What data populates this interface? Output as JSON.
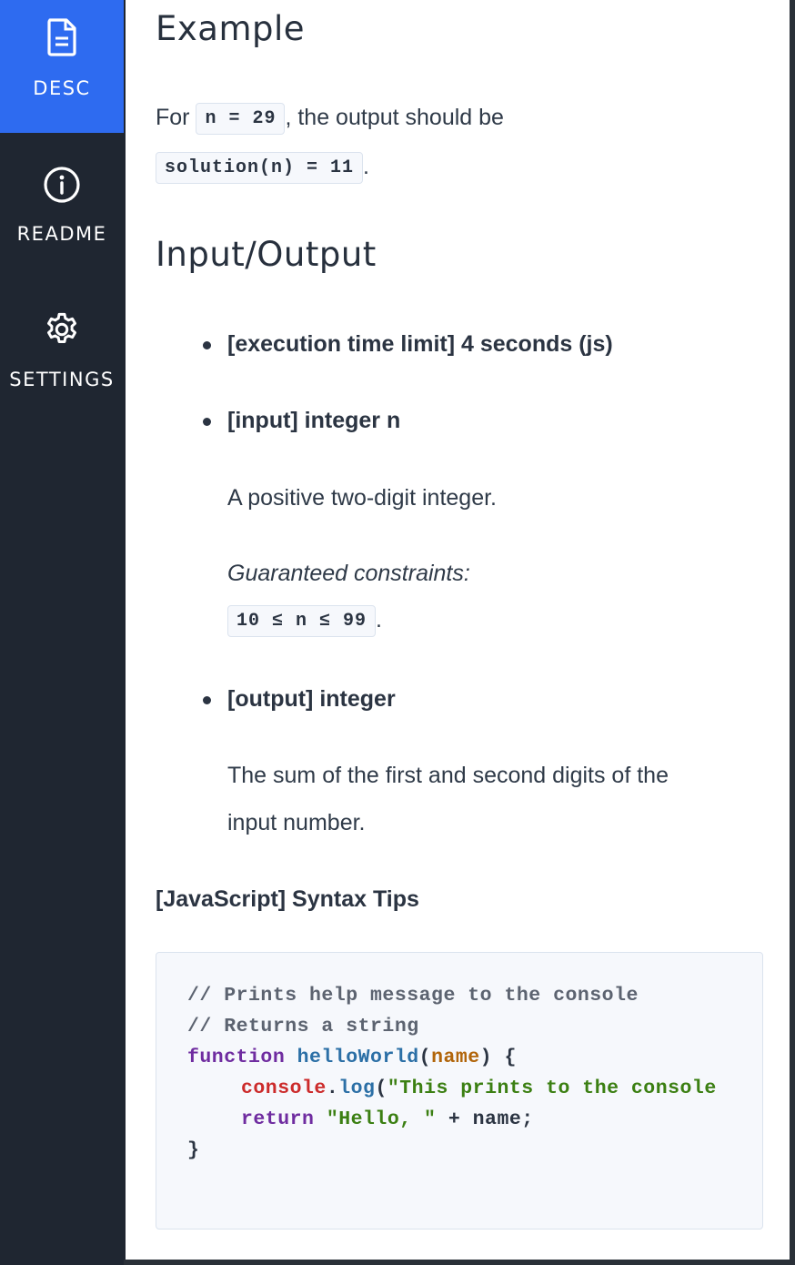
{
  "sidebar": {
    "items": [
      {
        "label": "DESC",
        "icon": "document-icon",
        "active": true
      },
      {
        "label": "README",
        "icon": "info-icon",
        "active": false
      },
      {
        "label": "SETTINGS",
        "icon": "gear-icon",
        "active": false
      }
    ]
  },
  "colors": {
    "accent": "#2e6bf0",
    "sidebar_bg": "#1f2631"
  },
  "example": {
    "heading": "Example",
    "for_text": "For",
    "input_code": "n = 29",
    "after_input": ", the output should be",
    "output_code": "solution(n) = 11",
    "period": "."
  },
  "io": {
    "heading": "Input/Output",
    "time_limit": "[execution time limit] 4 seconds (js)",
    "input_label": "[input] integer n",
    "input_desc": "A positive two-digit integer.",
    "constraints_label": "Guaranteed constraints:",
    "constraints_code": "10 ≤ n ≤ 99",
    "period": ".",
    "output_label": "[output] integer",
    "output_desc_line1": "The sum of the first and second digits of the",
    "output_desc_line2": "input number."
  },
  "syntax": {
    "heading": "[JavaScript] Syntax Tips",
    "comment1": "// Prints help message to the console",
    "comment2": "// Returns a string",
    "kw_function": "function",
    "fn_name": "helloWorld",
    "paren_open": "(",
    "param": "name",
    "sig_close": ") {",
    "obj_console": "console",
    "dot": ".",
    "method_log": "log",
    "log_open": "(",
    "log_string": "\"This prints to the console",
    "kw_return": "return",
    "ret_string": "\"Hello, \"",
    "ret_rest": " + name;",
    "closing_brace": "}"
  }
}
